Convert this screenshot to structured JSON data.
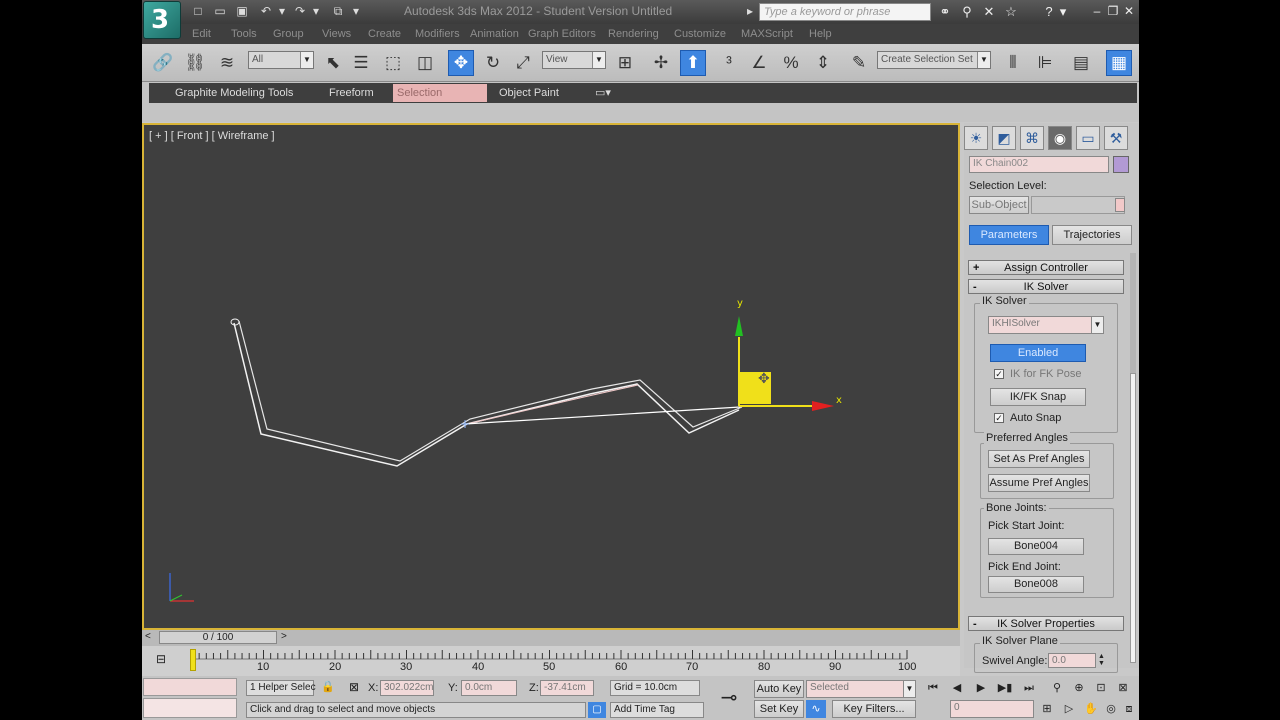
{
  "title": "Autodesk 3ds Max  2012  - Student Version    Untitled",
  "search_placeholder": "Type a keyword or phrase",
  "menu": [
    "Edit",
    "Tools",
    "Group",
    "Views",
    "Create",
    "Modifiers",
    "Animation",
    "Graph Editors",
    "Rendering",
    "Customize",
    "MAXScript",
    "Help"
  ],
  "toolbar": {
    "filter_value": "All",
    "refcoord_value": "View",
    "selection_set": "Create Selection Set"
  },
  "ribbon_tabs": [
    "Graphite Modeling Tools",
    "Freeform",
    "Selection",
    "Object Paint"
  ],
  "viewport_label": "[ + ] [ Front ] [ Wireframe ]",
  "gizmo": {
    "y": "y",
    "x": "x"
  },
  "panel": {
    "object_name": "IK Chain002",
    "selection_level_label": "Selection Level:",
    "sub_object_label": "Sub-Object",
    "tabs": [
      "Parameters",
      "Trajectories"
    ],
    "assign_controller": "Assign Controller",
    "ik_solver_rollout": "IK Solver",
    "ik_solver_group": "IK Solver",
    "solver_value": "IKHISolver",
    "enabled": "Enabled",
    "ik_for_fk_pose": "IK for FK Pose",
    "ikfk_snap": "IK/FK Snap",
    "auto_snap": "Auto Snap",
    "preferred_angles": "Preferred Angles",
    "set_pref": "Set As Pref Angles",
    "assume_pref": "Assume Pref Angles",
    "bone_joints": "Bone Joints:",
    "pick_start": "Pick Start Joint:",
    "start_bone": "Bone004",
    "pick_end": "Pick End Joint:",
    "end_bone": "Bone008",
    "ik_solver_properties": "IK Solver Properties",
    "ik_solver_plane": "IK Solver Plane",
    "swivel_label": "Swivel Angle:",
    "swivel_value": "0.0"
  },
  "timeline": {
    "frame": "0 / 100",
    "ticks": [
      "10",
      "20",
      "30",
      "40",
      "50",
      "60",
      "70",
      "80",
      "90",
      "100"
    ],
    "slider_value": 0,
    "frame_max": 100
  },
  "status": {
    "selection": "1 Helper Selec",
    "x_label": "X:",
    "x_value": "302.022cm",
    "y_label": "Y:",
    "y_value": "0.0cm",
    "z_label": "Z:",
    "z_value": "-37.41cm",
    "grid": "Grid = 10.0cm",
    "prompt": "Click and drag to select and move objects",
    "add_time_tag": "Add Time Tag",
    "auto_key": "Auto Key",
    "set_key": "Set Key",
    "selected_value": "Selected",
    "key_filters": "Key Filters...",
    "frame_field": "0"
  },
  "colors": {
    "accent": "#3f86e0",
    "viewport_border": "#d8b437",
    "bone": "#f2f2f2"
  }
}
